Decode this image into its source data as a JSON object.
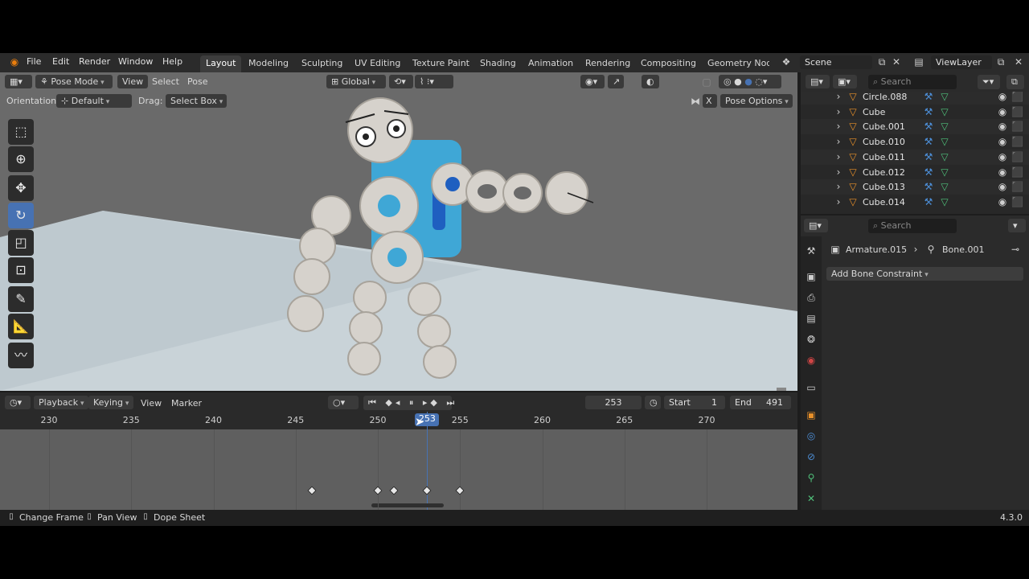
{
  "menu": [
    "File",
    "Edit",
    "Render",
    "Window",
    "Help"
  ],
  "workspaces": [
    {
      "label": "Layout",
      "active": true
    },
    {
      "label": "Modeling"
    },
    {
      "label": "Sculpting"
    },
    {
      "label": "UV Editing"
    },
    {
      "label": "Texture Paint"
    },
    {
      "label": "Shading"
    },
    {
      "label": "Animation"
    },
    {
      "label": "Rendering"
    },
    {
      "label": "Compositing"
    },
    {
      "label": "Geometry Node"
    }
  ],
  "scene": {
    "name": "Scene"
  },
  "view_layer": {
    "name": "ViewLayer"
  },
  "viewport": {
    "mode": "Pose Mode",
    "menus": [
      "View",
      "Select",
      "Pose"
    ],
    "transform_orientation": "Global",
    "orientation_label": "Orientation:",
    "orientation_value": "Default",
    "drag_label": "Drag:",
    "drag_value": "Select Box",
    "pose_options": "Pose Options",
    "x_mirror": "X"
  },
  "timeline": {
    "menus": [
      "Playback",
      "Keying",
      "View",
      "Marker"
    ],
    "current_frame": "253",
    "start_label": "Start",
    "start": "1",
    "end_label": "End",
    "end": "491",
    "ticks": [
      "230",
      "235",
      "240",
      "245",
      "250",
      "255",
      "260",
      "265",
      "270"
    ],
    "keyframes": [
      246,
      250,
      251,
      253,
      255
    ]
  },
  "outliner": {
    "search_placeholder": "Search",
    "items": [
      "Circle.088",
      "Cube",
      "Cube.001",
      "Cube.010",
      "Cube.011",
      "Cube.012",
      "Cube.013",
      "Cube.014"
    ]
  },
  "properties": {
    "search_placeholder": "Search",
    "object": "Armature.015",
    "bone": "Bone.001",
    "add_constraint": "Add Bone Constraint"
  },
  "status": {
    "items": [
      "Change Frame",
      "Pan View",
      "Dope Sheet"
    ],
    "version": "4.3.0"
  },
  "colors": {
    "accent": "#4772b3",
    "viewport_bg": "#6a6a6a",
    "floor": "#c9d3d8"
  }
}
